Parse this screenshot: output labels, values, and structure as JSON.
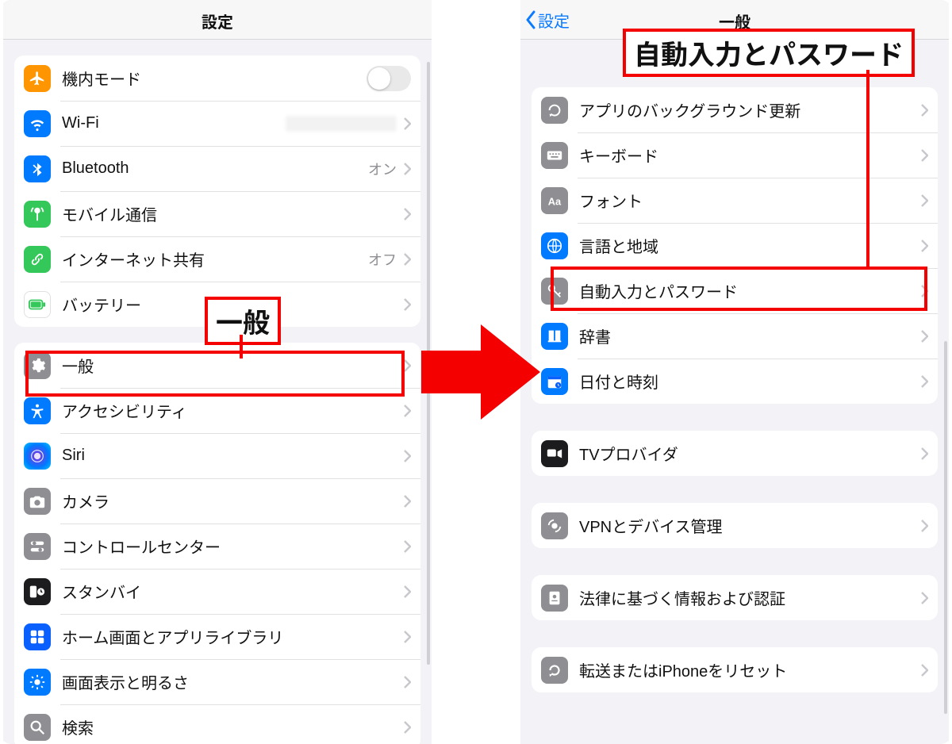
{
  "left": {
    "title": "設定",
    "callout_general": "一般",
    "group1": [
      {
        "key": "airplane",
        "label": "機内モード",
        "type": "toggle",
        "toggle": false
      },
      {
        "key": "wifi",
        "label": "Wi-Fi",
        "type": "link",
        "value": ""
      },
      {
        "key": "bluetooth",
        "label": "Bluetooth",
        "type": "link",
        "value": "オン"
      },
      {
        "key": "cellular",
        "label": "モバイル通信",
        "type": "link"
      },
      {
        "key": "hotspot",
        "label": "インターネット共有",
        "type": "link",
        "value": "オフ"
      },
      {
        "key": "battery",
        "label": "バッテリー",
        "type": "link"
      }
    ],
    "group2": [
      {
        "key": "general",
        "label": "一般",
        "type": "link"
      },
      {
        "key": "accessibility",
        "label": "アクセシビリティ",
        "type": "link"
      },
      {
        "key": "siri",
        "label": "Siri",
        "type": "link"
      },
      {
        "key": "camera",
        "label": "カメラ",
        "type": "link"
      },
      {
        "key": "controlcenter",
        "label": "コントロールセンター",
        "type": "link"
      },
      {
        "key": "standby",
        "label": "スタンバイ",
        "type": "link"
      },
      {
        "key": "homescreen",
        "label": "ホーム画面とアプリライブラリ",
        "type": "link"
      },
      {
        "key": "display",
        "label": "画面表示と明るさ",
        "type": "link"
      },
      {
        "key": "search",
        "label": "検索",
        "type": "link"
      }
    ]
  },
  "right": {
    "back": "設定",
    "title": "一般",
    "callout_autofill": "自動入力とパスワード",
    "group1": [
      {
        "key": "bgrefresh",
        "label": "アプリのバックグラウンド更新"
      },
      {
        "key": "keyboard",
        "label": "キーボード"
      },
      {
        "key": "fonts",
        "label": "フォント"
      },
      {
        "key": "langregion",
        "label": "言語と地域"
      },
      {
        "key": "autofill",
        "label": "自動入力とパスワード"
      },
      {
        "key": "dictionary",
        "label": "辞書"
      },
      {
        "key": "datetime",
        "label": "日付と時刻"
      }
    ],
    "group2": [
      {
        "key": "tvprovider",
        "label": "TVプロバイダ"
      }
    ],
    "group3": [
      {
        "key": "vpn",
        "label": "VPNとデバイス管理"
      }
    ],
    "group4": [
      {
        "key": "legal",
        "label": "法律に基づく情報および認証"
      }
    ],
    "group5": [
      {
        "key": "reset",
        "label": "転送またはiPhoneをリセット"
      }
    ]
  },
  "iconmap": {
    "airplane": {
      "bg": "bg-orange",
      "svg": "plane"
    },
    "wifi": {
      "bg": "bg-blue",
      "svg": "wifi"
    },
    "bluetooth": {
      "bg": "bg-blue",
      "svg": "bt"
    },
    "cellular": {
      "bg": "bg-green",
      "svg": "antenna"
    },
    "hotspot": {
      "bg": "bg-green",
      "svg": "link"
    },
    "battery": {
      "bg": "bg-white",
      "svg": "battery"
    },
    "general": {
      "bg": "bg-sysgrey",
      "svg": "gear"
    },
    "accessibility": {
      "bg": "bg-blue",
      "svg": "access"
    },
    "siri": {
      "bg": "bg-siri",
      "svg": "siri"
    },
    "camera": {
      "bg": "bg-sysgrey",
      "svg": "camera"
    },
    "controlcenter": {
      "bg": "bg-sysgrey",
      "svg": "sliders"
    },
    "standby": {
      "bg": "bg-black",
      "svg": "clock"
    },
    "homescreen": {
      "bg": "bg-royal",
      "svg": "homegrid"
    },
    "display": {
      "bg": "bg-blue",
      "svg": "sun"
    },
    "search": {
      "bg": "bg-sysgrey",
      "svg": "search"
    },
    "bgrefresh": {
      "bg": "bg-sysgrey",
      "svg": "refresh"
    },
    "keyboard": {
      "bg": "bg-sysgrey",
      "svg": "keyboard"
    },
    "fonts": {
      "bg": "bg-sysgrey",
      "svg": "fonts"
    },
    "langregion": {
      "bg": "bg-blue",
      "svg": "globe"
    },
    "autofill": {
      "bg": "bg-sysgrey",
      "svg": "key"
    },
    "dictionary": {
      "bg": "bg-blue",
      "svg": "book"
    },
    "datetime": {
      "bg": "bg-blue",
      "svg": "calendar"
    },
    "tvprovider": {
      "bg": "bg-black",
      "svg": "tv"
    },
    "vpn": {
      "bg": "bg-sysgrey",
      "svg": "vpn"
    },
    "legal": {
      "bg": "bg-sysgrey",
      "svg": "cert"
    },
    "reset": {
      "bg": "bg-sysgrey",
      "svg": "resetarrow"
    }
  }
}
